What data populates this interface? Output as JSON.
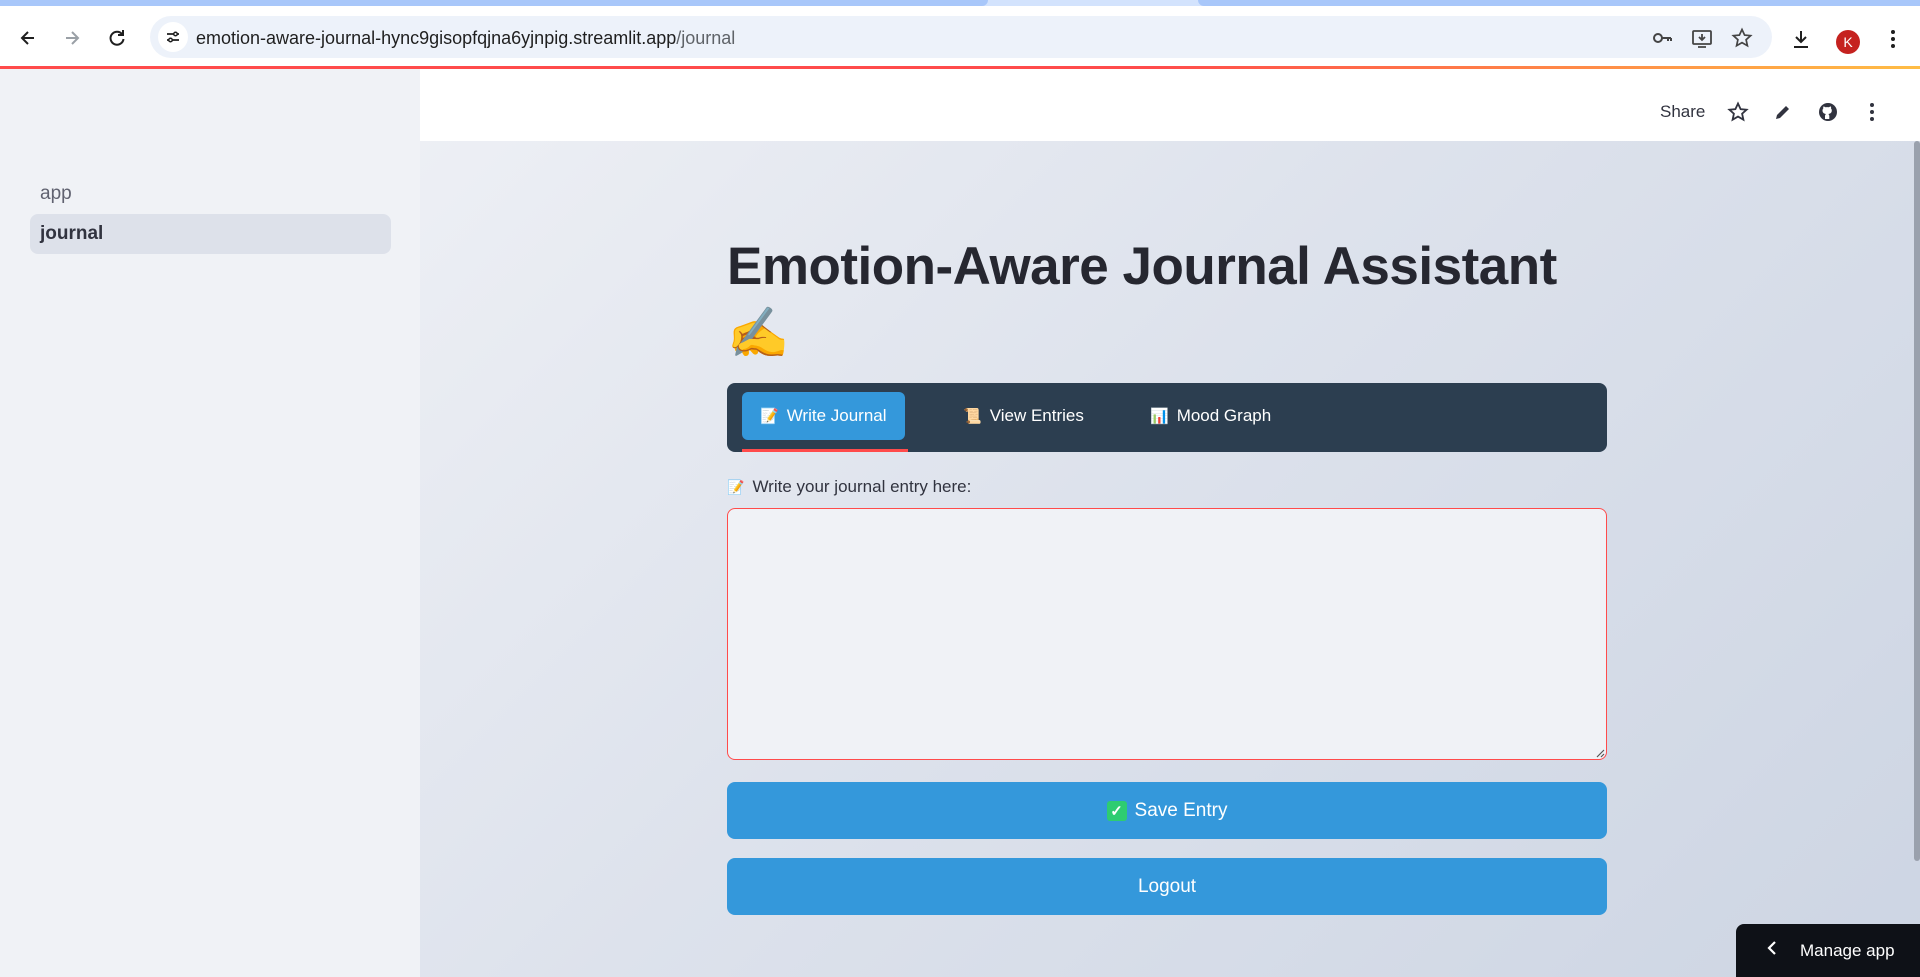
{
  "browser": {
    "url_host": "emotion-aware-journal-hync9gisopfqjna6yjnpig.streamlit.app",
    "url_path": "/journal",
    "profile_initial": "K"
  },
  "sidebar": {
    "items": [
      {
        "label": "app",
        "active": false
      },
      {
        "label": "journal",
        "active": true
      }
    ]
  },
  "header": {
    "share_label": "Share"
  },
  "main": {
    "title": "Emotion-Aware Journal Assistant",
    "title_emoji": "✍️",
    "tabs": [
      {
        "emoji": "📝",
        "label": "Write Journal",
        "active": true
      },
      {
        "emoji": "📜",
        "label": "View Entries",
        "active": false
      },
      {
        "emoji": "📊",
        "label": "Mood Graph",
        "active": false
      }
    ],
    "entry_label_emoji": "📝",
    "entry_label": "Write your journal entry here:",
    "entry_value": "",
    "save_emoji": "✓",
    "save_label": "Save Entry",
    "logout_label": "Logout"
  },
  "manage_app": {
    "label": "Manage app"
  },
  "colors": {
    "accent": "#3498db",
    "tab_bar": "#2c3e50",
    "error_red": "#ff4b4b",
    "manage_bg": "#0e1117"
  }
}
